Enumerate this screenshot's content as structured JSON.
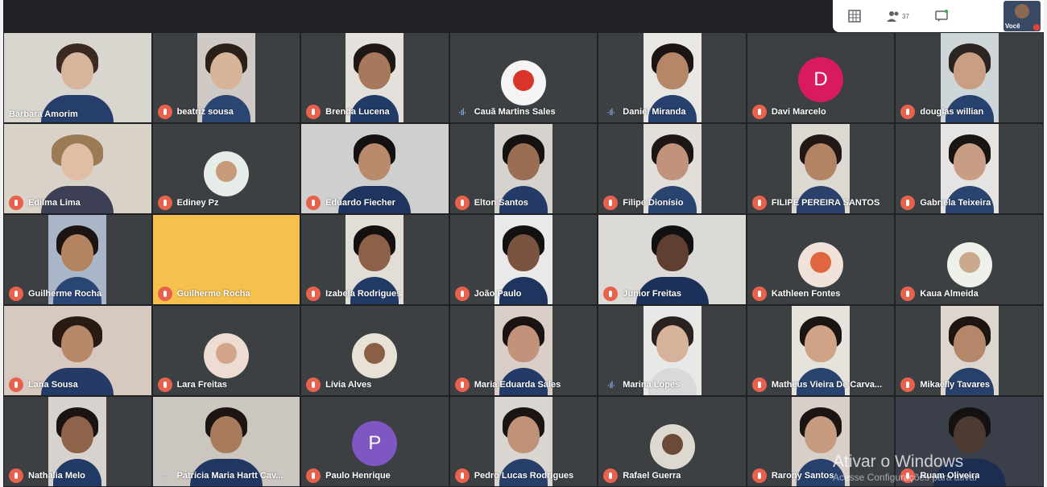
{
  "topbar": {
    "participants_count": "37",
    "self_label": "Você"
  },
  "colors": {
    "grid_bg": "#202124",
    "tile_bg": "#3c4043",
    "mic_muted": "#e8614d",
    "avatar_d": "#d81b60",
    "avatar_p": "#7e57c2"
  },
  "participants": [
    {
      "name": "Bárbara Amorim",
      "status": "muted"
    },
    {
      "name": "beatriz sousa",
      "status": "muted"
    },
    {
      "name": "Brenda Lucena",
      "status": "muted"
    },
    {
      "name": "Cauã Martins Sales",
      "status": "speaking"
    },
    {
      "name": "Daniel Miranda",
      "status": "speaking"
    },
    {
      "name": "Davi Marcelo",
      "status": "muted",
      "initial": "D"
    },
    {
      "name": "douglas willian",
      "status": "muted"
    },
    {
      "name": "Edilma Lima",
      "status": "muted"
    },
    {
      "name": "Ediney Pz",
      "status": "muted"
    },
    {
      "name": "Eduardo Fiecher",
      "status": "muted"
    },
    {
      "name": "Elton Santos",
      "status": "muted"
    },
    {
      "name": "Filipe Dionísio",
      "status": "muted"
    },
    {
      "name": "FILIPE PEREIRA SANTOS",
      "status": "muted"
    },
    {
      "name": "Gabriela Teixeira",
      "status": "muted"
    },
    {
      "name": "Guilherme Rocha",
      "status": "muted"
    },
    {
      "name": "Guilherme Rocha",
      "status": "muted"
    },
    {
      "name": "Izabela Rodrigues",
      "status": "muted"
    },
    {
      "name": "João Paulo",
      "status": "muted"
    },
    {
      "name": "Junior Freitas",
      "status": "muted"
    },
    {
      "name": "Kathleen Fontes",
      "status": "muted"
    },
    {
      "name": "Kaua Almeida",
      "status": "muted"
    },
    {
      "name": "Lana Sousa",
      "status": "muted"
    },
    {
      "name": "Lara Freitas",
      "status": "muted"
    },
    {
      "name": "Lívia Alves",
      "status": "muted"
    },
    {
      "name": "Maria Eduarda Sales",
      "status": "muted"
    },
    {
      "name": "Marina Lopes",
      "status": "speaking"
    },
    {
      "name": "Matheus Vieira De Carva...",
      "status": "muted"
    },
    {
      "name": "Mikaelly Tavares",
      "status": "muted"
    },
    {
      "name": "Nathalia Melo",
      "status": "muted"
    },
    {
      "name": "Patricia Maria Hartt Cav...",
      "status": "speaking"
    },
    {
      "name": "Paulo Henrique",
      "status": "muted",
      "initial": "P"
    },
    {
      "name": "Pedro Lucas Rodrigues",
      "status": "muted"
    },
    {
      "name": "Rafael Guerra",
      "status": "muted"
    },
    {
      "name": "Rarony Santos",
      "status": "muted"
    },
    {
      "name": "Ruam Oliveira",
      "status": "muted"
    }
  ],
  "watermark": {
    "title": "Ativar o Windows",
    "subtitle": "Acesse Configurações para ativar"
  }
}
